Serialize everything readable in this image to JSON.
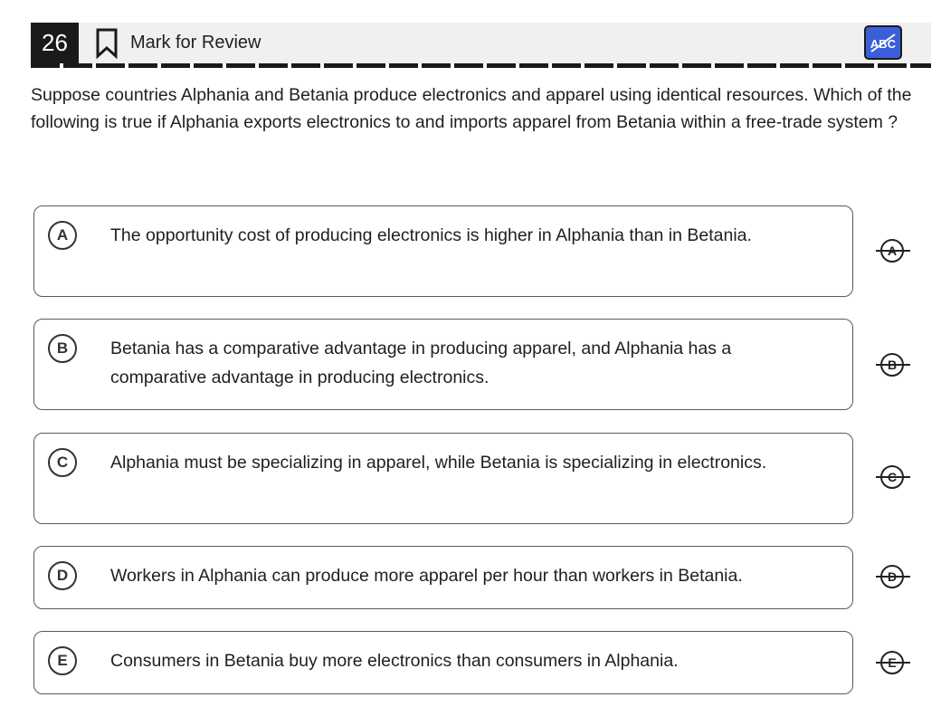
{
  "header": {
    "question_number": "26",
    "mark_for_review_label": "Mark for Review",
    "abc_toggle_label": "ABC"
  },
  "question": {
    "text": "Suppose countries Alphania and Betania produce electronics and apparel using identical resources. Which of the following is true if Alphania exports electronics to and imports apparel from Betania within a free-trade system ?"
  },
  "options": [
    {
      "letter": "A",
      "text": "The opportunity cost of producing electronics is higher in Alphania than in Betania."
    },
    {
      "letter": "B",
      "text": "Betania has a comparative advantage in producing apparel, and Alphania has a comparative advantage in producing electronics."
    },
    {
      "letter": "C",
      "text": "Alphania must be specializing in apparel, while Betania is specializing in electronics."
    },
    {
      "letter": "D",
      "text": "Workers in Alphania can produce more apparel per hour than workers in Betania."
    },
    {
      "letter": "E",
      "text": "Consumers in Betania buy more electronics than consumers in Alphania."
    }
  ],
  "icons": {
    "bookmark": "bookmark-outline-icon",
    "abc_toggle": "abc-strikethrough-icon",
    "eliminate": "strikethrough-letter-icon"
  },
  "colors": {
    "question_number_bg": "#1a1a1a",
    "abc_toggle_bg": "#3b5fd9",
    "topbar_bg": "#f0f0f0"
  }
}
